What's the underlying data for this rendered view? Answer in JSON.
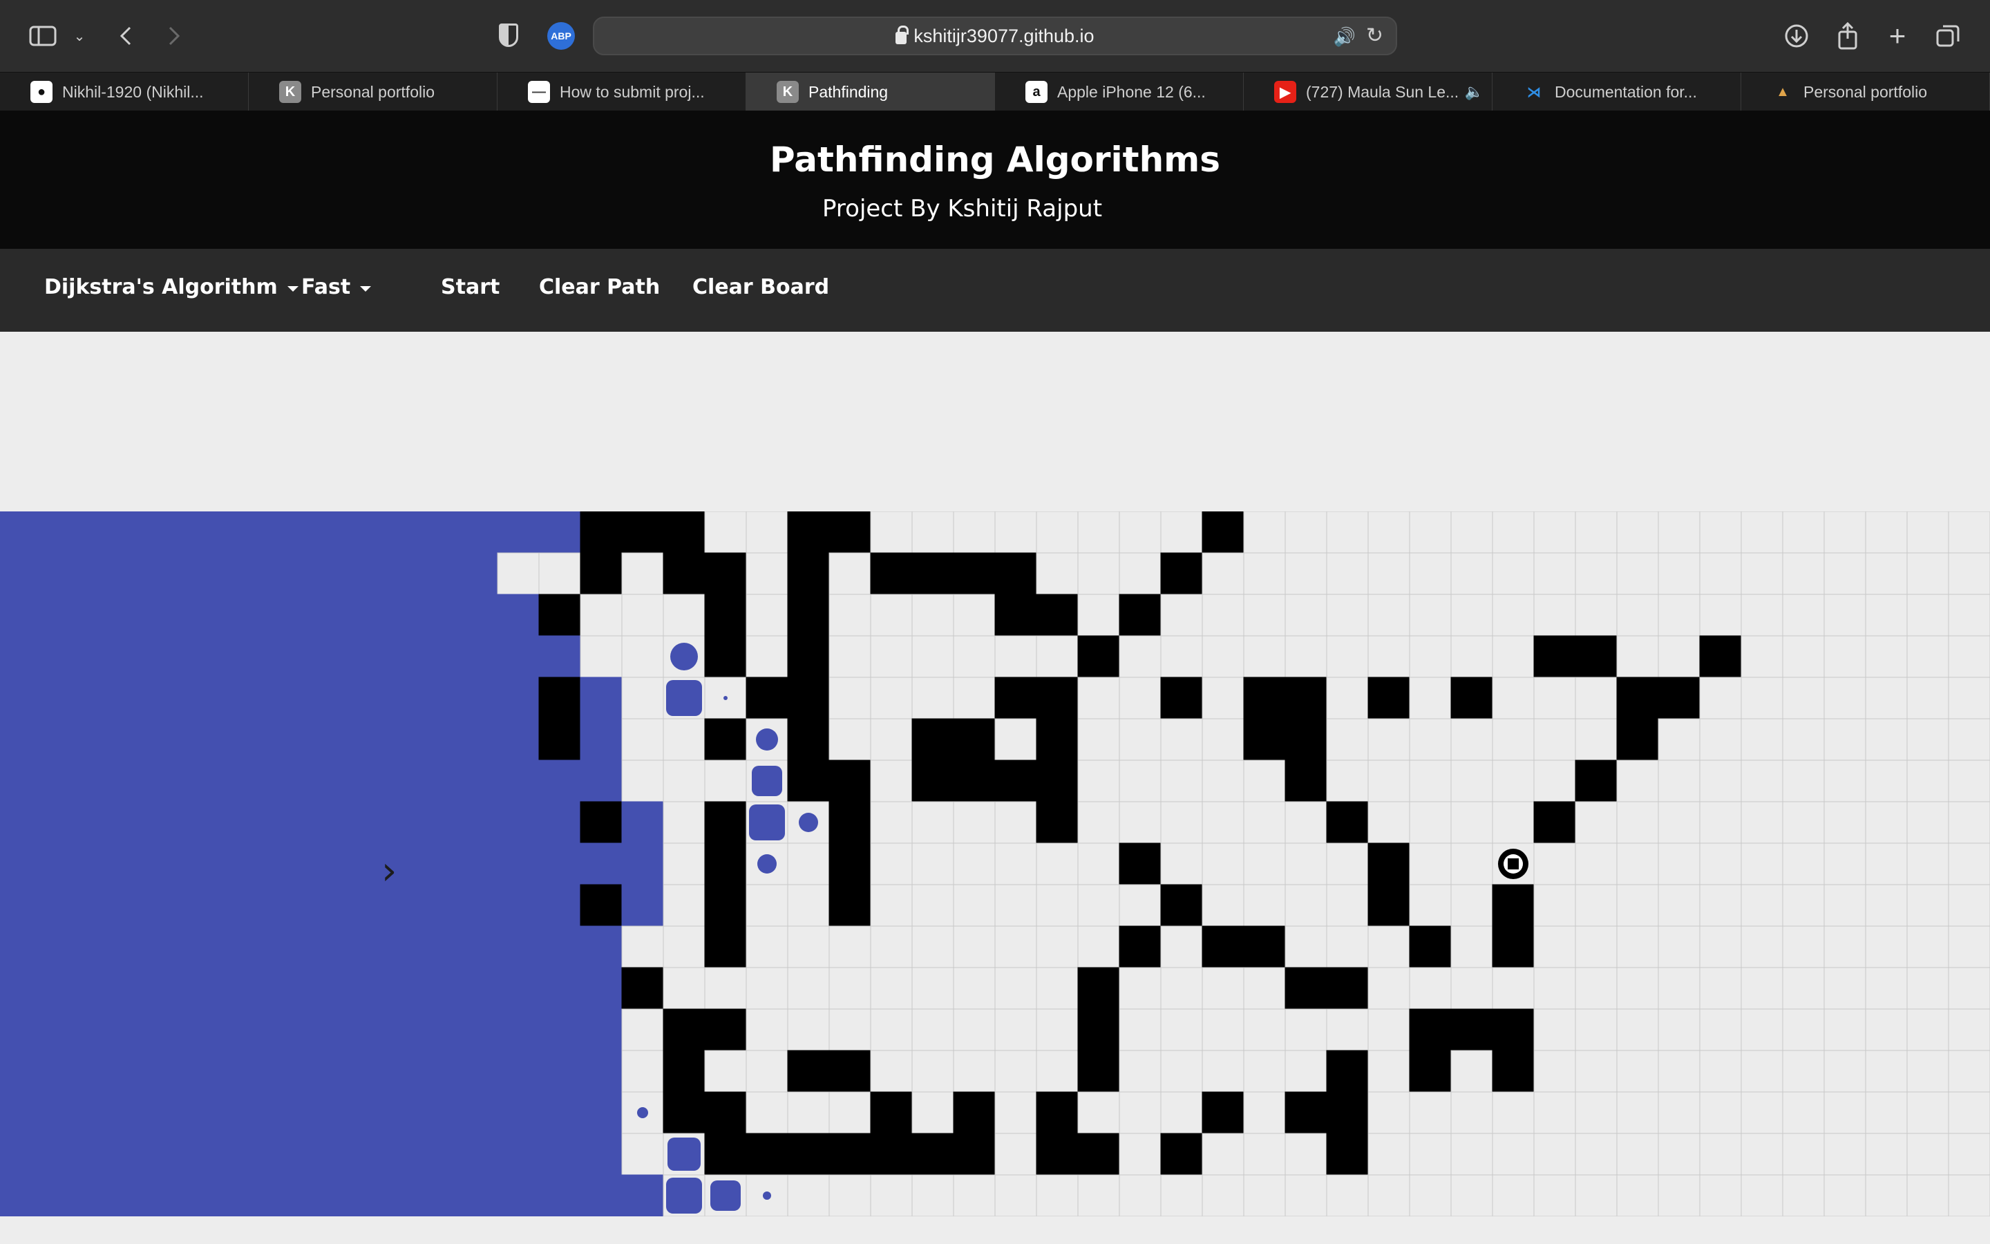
{
  "browser": {
    "url": "kshitijr39077.github.io",
    "tabs": [
      {
        "label": "Nikhil-1920 (Nikhil...",
        "icon": "github-icon",
        "active": false,
        "muted": false
      },
      {
        "label": "Personal portfolio",
        "icon": "k-logo-icon",
        "active": false,
        "muted": false
      },
      {
        "label": "How to submit proj...",
        "icon": "page-icon",
        "active": false,
        "muted": false
      },
      {
        "label": "Pathfinding",
        "icon": "k-logo-icon",
        "active": true,
        "muted": false
      },
      {
        "label": "Apple iPhone 12 (6...",
        "icon": "amazon-icon",
        "active": false,
        "muted": false
      },
      {
        "label": "(727) Maula Sun Le...",
        "icon": "youtube-icon",
        "active": false,
        "muted": true
      },
      {
        "label": "Documentation for...",
        "icon": "vscode-icon",
        "active": false,
        "muted": false
      },
      {
        "label": "Personal portfolio",
        "icon": "mountain-icon",
        "active": false,
        "muted": false
      }
    ]
  },
  "header": {
    "title": "Pathfinding Algorithms",
    "subtitle": "Project By Kshitij Rajput"
  },
  "nav": {
    "algorithm": "Dijkstra's Algorithm",
    "speed": "Fast",
    "start": "Start",
    "clear_path": "Clear Path",
    "clear_board": "Clear Board"
  },
  "colors": {
    "visited": "#4450b0",
    "wall": "#000000",
    "empty": "#ececec",
    "grid_line": "#c8c8c8",
    "header_bg": "#0a0a0a",
    "nav_bg": "#2a2a2a"
  },
  "board": {
    "rows": 17,
    "cols": 48,
    "walls": [
      [
        0,
        14
      ],
      [
        0,
        15
      ],
      [
        0,
        16
      ],
      [
        0,
        19
      ],
      [
        0,
        20
      ],
      [
        0,
        29
      ],
      [
        1,
        14
      ],
      [
        1,
        16
      ],
      [
        1,
        17
      ],
      [
        1,
        19
      ],
      [
        1,
        21
      ],
      [
        1,
        22
      ],
      [
        1,
        23
      ],
      [
        1,
        24
      ],
      [
        1,
        28
      ],
      [
        2,
        13
      ],
      [
        2,
        17
      ],
      [
        2,
        19
      ],
      [
        2,
        24
      ],
      [
        2,
        25
      ],
      [
        2,
        27
      ],
      [
        3,
        17
      ],
      [
        3,
        19
      ],
      [
        3,
        26
      ],
      [
        3,
        37
      ],
      [
        3,
        38
      ],
      [
        3,
        41
      ],
      [
        4,
        13
      ],
      [
        4,
        18
      ],
      [
        4,
        19
      ],
      [
        4,
        24
      ],
      [
        4,
        25
      ],
      [
        4,
        28
      ],
      [
        4,
        30
      ],
      [
        4,
        31
      ],
      [
        4,
        33
      ],
      [
        4,
        35
      ],
      [
        4,
        39
      ],
      [
        4,
        40
      ],
      [
        5,
        13
      ],
      [
        5,
        17
      ],
      [
        5,
        19
      ],
      [
        5,
        22
      ],
      [
        5,
        23
      ],
      [
        5,
        25
      ],
      [
        5,
        30
      ],
      [
        5,
        31
      ],
      [
        5,
        39
      ],
      [
        6,
        19
      ],
      [
        6,
        20
      ],
      [
        6,
        22
      ],
      [
        6,
        23
      ],
      [
        6,
        24
      ],
      [
        6,
        25
      ],
      [
        6,
        31
      ],
      [
        6,
        38
      ],
      [
        7,
        14
      ],
      [
        7,
        17
      ],
      [
        7,
        20
      ],
      [
        7,
        25
      ],
      [
        7,
        32
      ],
      [
        7,
        37
      ],
      [
        8,
        17
      ],
      [
        8,
        20
      ],
      [
        8,
        27
      ],
      [
        8,
        33
      ],
      [
        9,
        14
      ],
      [
        9,
        17
      ],
      [
        9,
        20
      ],
      [
        9,
        28
      ],
      [
        9,
        33
      ],
      [
        9,
        36
      ],
      [
        10,
        17
      ],
      [
        10,
        27
      ],
      [
        10,
        29
      ],
      [
        10,
        30
      ],
      [
        10,
        34
      ],
      [
        10,
        36
      ],
      [
        11,
        15
      ],
      [
        11,
        26
      ],
      [
        11,
        31
      ],
      [
        11,
        32
      ],
      [
        12,
        16
      ],
      [
        12,
        17
      ],
      [
        12,
        26
      ],
      [
        12,
        34
      ],
      [
        12,
        35
      ],
      [
        12,
        36
      ],
      [
        13,
        16
      ],
      [
        13,
        19
      ],
      [
        13,
        20
      ],
      [
        13,
        26
      ],
      [
        13,
        32
      ],
      [
        13,
        34
      ],
      [
        13,
        36
      ],
      [
        14,
        16
      ],
      [
        14,
        17
      ],
      [
        14,
        21
      ],
      [
        14,
        23
      ],
      [
        14,
        25
      ],
      [
        14,
        29
      ],
      [
        14,
        31
      ],
      [
        14,
        32
      ],
      [
        15,
        17
      ],
      [
        15,
        18
      ],
      [
        15,
        19
      ],
      [
        15,
        20
      ],
      [
        15,
        21
      ],
      [
        15,
        22
      ],
      [
        15,
        23
      ],
      [
        15,
        25
      ],
      [
        15,
        26
      ],
      [
        15,
        28
      ],
      [
        15,
        32
      ]
    ],
    "target": [
      8,
      36
    ]
  },
  "icons": {
    "sidebar": "sidebar-icon",
    "back": "chevron-left-icon",
    "forward": "chevron-right-icon",
    "download": "download-icon",
    "share": "share-icon",
    "new_tab": "plus-icon",
    "tab_overview": "tabs-icon",
    "expand": "chevron-right-icon"
  }
}
